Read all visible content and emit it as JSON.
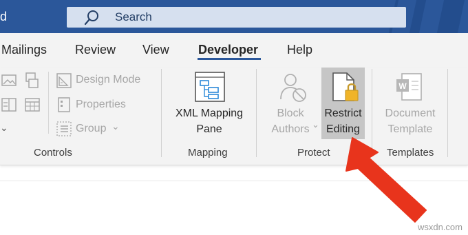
{
  "titlebar": {
    "title_fragment": "d",
    "search": {
      "label": "Search",
      "icon": "search-icon"
    },
    "color": "#2b579a"
  },
  "tabs": [
    {
      "label": "Mailings",
      "active": false
    },
    {
      "label": "Review",
      "active": false
    },
    {
      "label": "View",
      "active": false
    },
    {
      "label": "Developer",
      "active": true
    },
    {
      "label": "Help",
      "active": false
    }
  ],
  "controls_group": {
    "label": "Controls",
    "items": [
      {
        "label": "Design Mode",
        "icon": "design-mode-icon"
      },
      {
        "label": "Properties",
        "icon": "properties-icon"
      },
      {
        "label": "Group",
        "icon": "group-icon"
      }
    ]
  },
  "mapping_group": {
    "label": "Mapping",
    "button": {
      "line1": "XML Mapping",
      "line2": "Pane",
      "icon": "xml-mapping-pane-icon"
    }
  },
  "protect_group": {
    "label": "Protect",
    "block_authors": {
      "line1": "Block",
      "line2": "Authors",
      "icon": "block-authors-icon"
    },
    "restrict_editing": {
      "line1": "Restrict",
      "line2": "Editing",
      "icon": "restrict-editing-icon"
    }
  },
  "templates_group": {
    "label": "Templates",
    "document_template": {
      "line1": "Document",
      "line2": "Template",
      "icon": "document-template-icon"
    }
  },
  "watermark": "wsxdn.com",
  "colors": {
    "accent": "#2b579a",
    "arrow": "#e8341c",
    "disabled_text": "#a6a6a6"
  }
}
